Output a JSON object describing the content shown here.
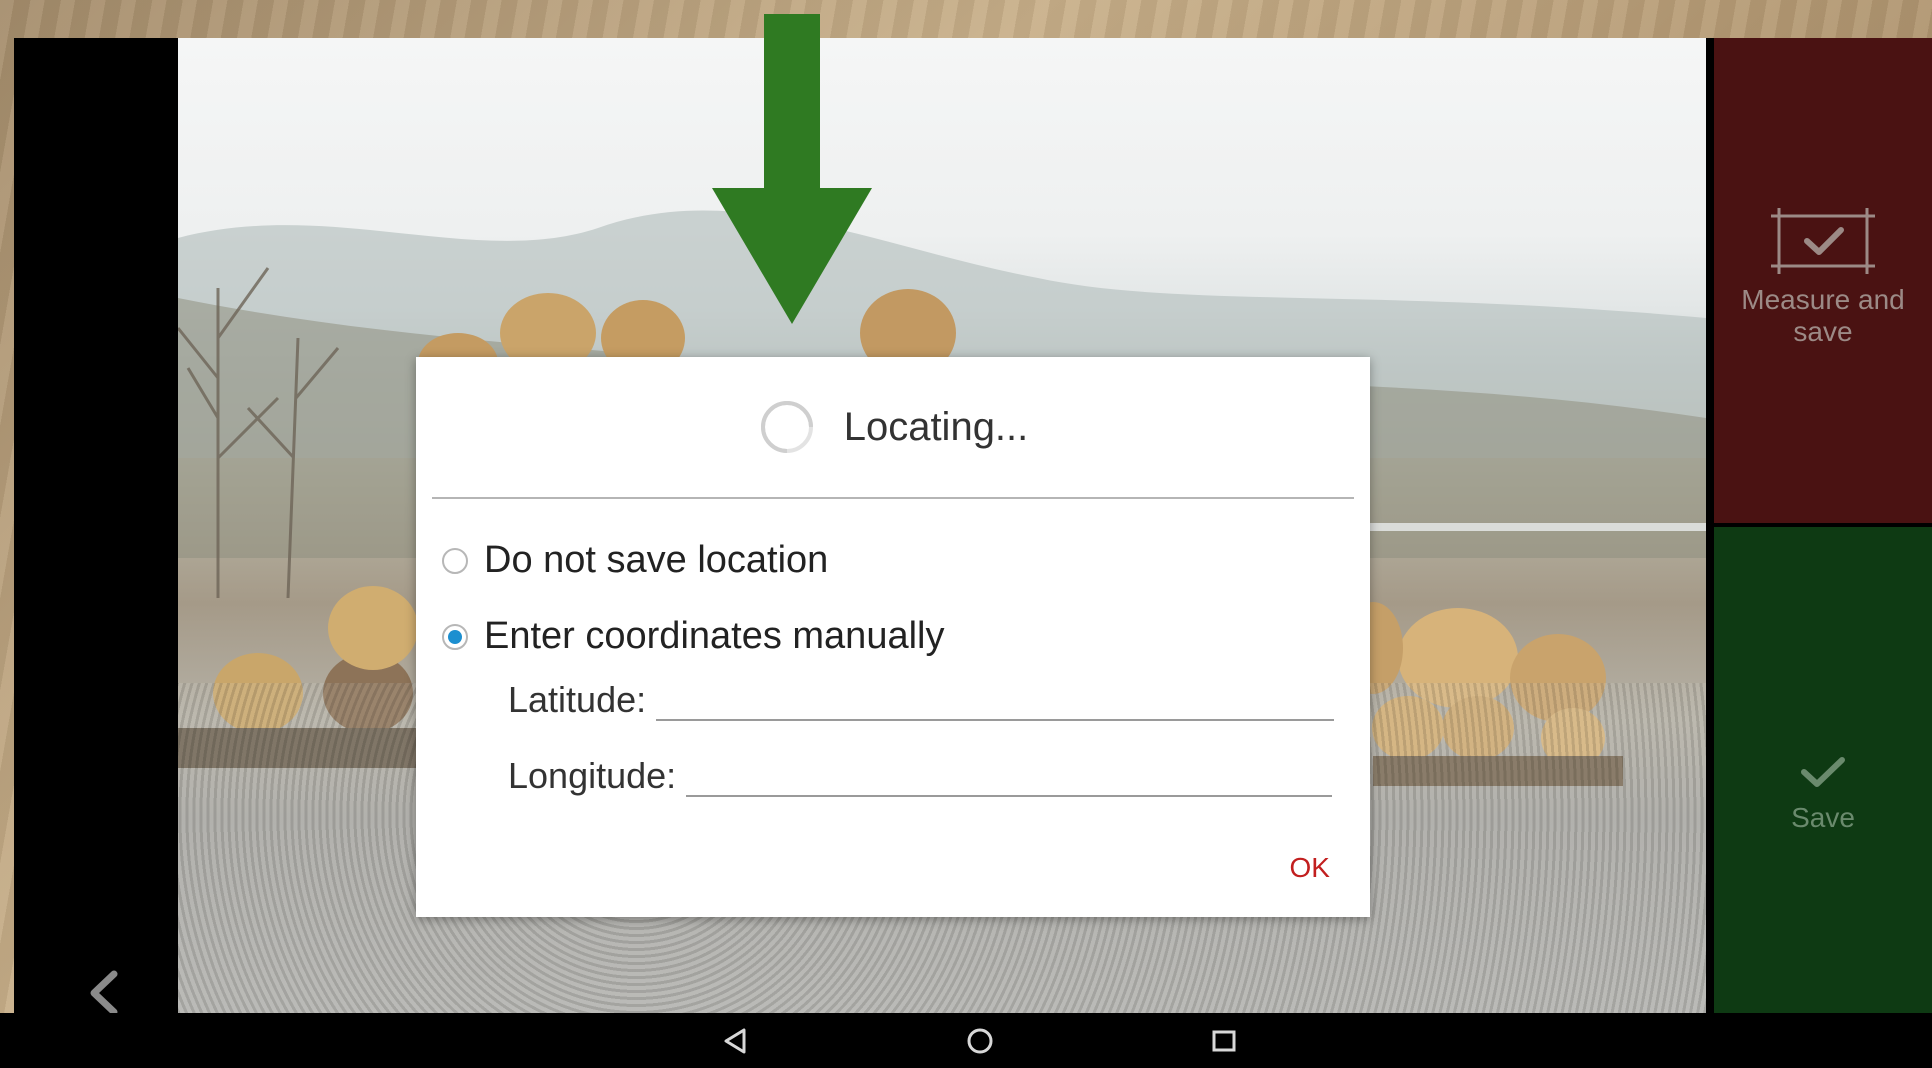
{
  "dialog": {
    "title": "Locating...",
    "options": [
      {
        "label": "Do not save location",
        "checked": false
      },
      {
        "label": "Enter coordinates manually",
        "checked": true
      }
    ],
    "latitude": {
      "label": "Latitude:",
      "value": ""
    },
    "longitude": {
      "label": "Longitude:",
      "value": ""
    },
    "ok_label": "OK"
  },
  "side_panel": {
    "measure_and_save": {
      "label": "Measure and save",
      "icon": "frame-check-icon"
    },
    "save": {
      "label": "Save",
      "icon": "checkmark-icon"
    }
  },
  "nav_bar": {
    "icons": [
      "nav-back-icon",
      "nav-home-icon",
      "nav-recents-icon"
    ]
  },
  "colors": {
    "measure_panel": "#4a1212",
    "save_panel": "#0e3a13",
    "arrow": "#2f7a22",
    "radio_selected": "#1c8fd0",
    "ok_text": "#c21f1f"
  }
}
